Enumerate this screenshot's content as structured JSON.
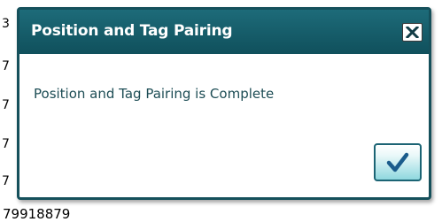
{
  "background": {
    "left_fragments": [
      "3",
      "7",
      "7",
      "7",
      "7"
    ],
    "bottom_text": "79918879"
  },
  "dialog": {
    "title": "Position and Tag Pairing",
    "message": "Position and Tag Pairing is Complete",
    "close_icon": "close-x-icon",
    "ok_icon": "checkmark-icon"
  },
  "colors": {
    "titlebar": "#15616e",
    "message_text": "#1d4d55",
    "ok_button_fill": "#8fd8df",
    "checkmark": "#1b5c8c"
  }
}
